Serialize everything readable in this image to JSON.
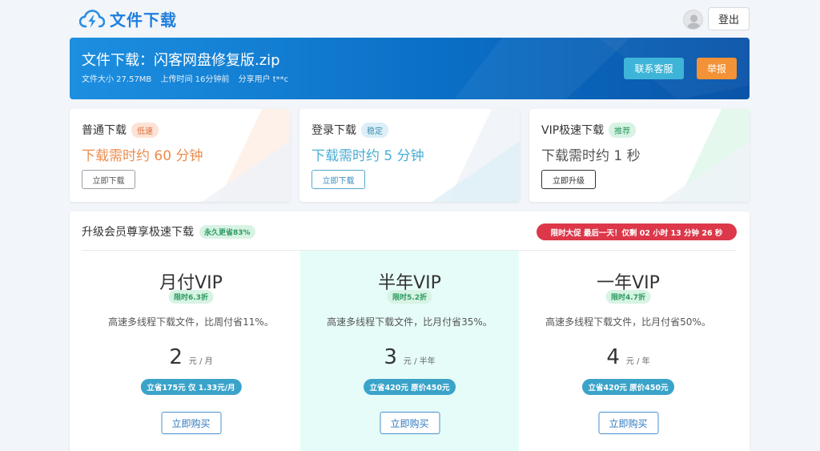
{
  "header": {
    "logo_text": "文件下载",
    "logout_label": "登出"
  },
  "banner": {
    "file_title": "文件下载：闪客网盘修复版.zip",
    "size": "文件大小 27.57MB",
    "upload_time": "上传时间 16分钟前",
    "share_user": "分享用户 t**c",
    "service_label": "联系客服",
    "report_label": "举报"
  },
  "downloads": [
    {
      "name": "普通下载",
      "tag": "低速",
      "time": "下载需时约 60 分钟",
      "button": "立即下载"
    },
    {
      "name": "登录下载",
      "tag": "稳定",
      "time": "下载需时约 5 分钟",
      "button": "立即下载"
    },
    {
      "name": "VIP极速下载",
      "tag": "推荐",
      "time": "下载需时约 1 秒",
      "button": "立即升级"
    }
  ],
  "vip": {
    "title": "升级会员尊享极速下载",
    "badge": "永久更省83%",
    "promo": "限时大促 最后一天！仅剩 02 小时 13 分钟 26 秒",
    "plans": [
      {
        "name": "月付VIP",
        "badge": "限时6.3折",
        "desc": "高速多线程下载文件，比周付省11%。",
        "price": "2",
        "unit": "元 / 月",
        "save": "立省175元 仅 1.33元/月",
        "button": "立即购买"
      },
      {
        "name": "半年VIP",
        "badge": "限时5.2折",
        "desc": "高速多线程下载文件，比月付省35%。",
        "price": "3",
        "unit": "元 / 半年",
        "save": "立省420元 原价450元",
        "button": "立即购买"
      },
      {
        "name": "一年VIP",
        "badge": "限时4.7折",
        "desc": "高速多线程下载文件，比月付省50%。",
        "price": "4",
        "unit": "元 / 年",
        "save": "立省420元 原价450元",
        "button": "立即购买"
      }
    ]
  },
  "colors": {
    "brand": "#1f7fdc",
    "banner_start": "#1d8fe0",
    "banner_end": "#0a54a8",
    "service": "#3eb5d8",
    "report": "#f39237",
    "promo": "#dc3849",
    "highlight_plan": "#e6fcf8"
  }
}
